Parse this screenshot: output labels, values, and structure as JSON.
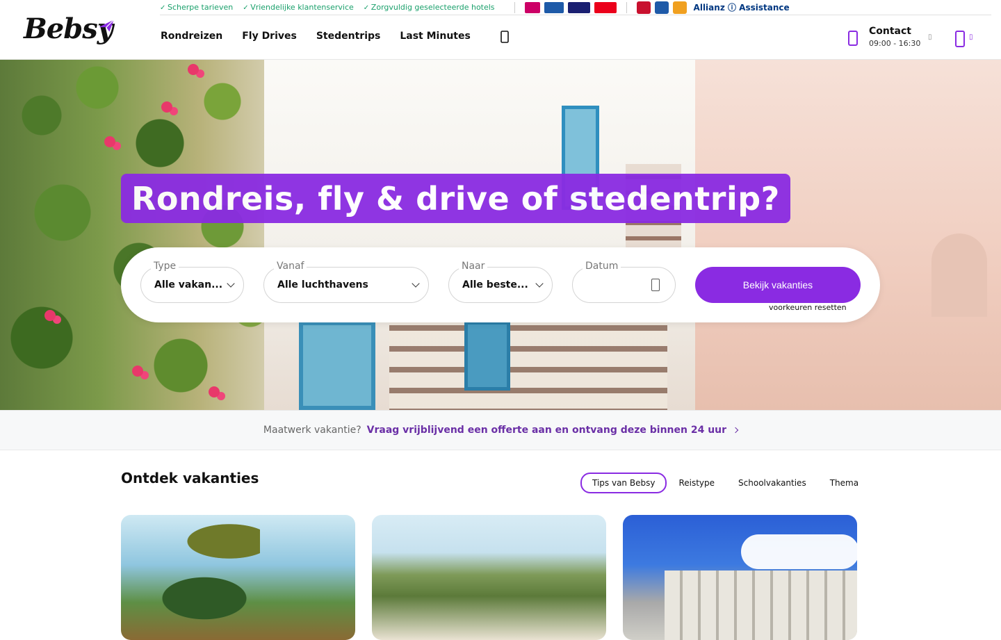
{
  "header": {
    "logo_text": "Bebsy",
    "usps": [
      "Scherpe tarieven",
      "Vriendelijke klantenservice",
      "Zorgvuldig geselecteerde hotels"
    ],
    "payment_icons": [
      "ideal-icon",
      "bancontact-icon",
      "visa-icon",
      "mastercard-icon"
    ],
    "trust_icons": [
      "reisgarantie-icon",
      "anvr-icon",
      "sgr-icon"
    ],
    "insurance_label": "Allianz ⓘ Assistance",
    "nav": [
      "Rondreizen",
      "Fly Drives",
      "Stedentrips",
      "Last Minutes"
    ],
    "contact": {
      "title": "Contact",
      "hours": "09:00 - 16:30"
    }
  },
  "hero": {
    "headline": "Rondreis, fly & drive of stedentrip?",
    "search": {
      "type": {
        "label": "Type",
        "value": "Alle vakan..."
      },
      "from": {
        "label": "Vanaf",
        "value": "Alle luchthavens"
      },
      "to": {
        "label": "Naar",
        "value": "Alle beste..."
      },
      "date": {
        "label": "Datum",
        "value": ""
      },
      "button": "Bekijk vakanties",
      "reset": "voorkeuren resetten"
    }
  },
  "promo": {
    "lead": "Maatwerk vakantie?",
    "link": "Vraag vrijblijvend een offerte aan en ontvang deze binnen 24 uur"
  },
  "discover": {
    "title": "Ontdek vakanties",
    "tabs": [
      "Tips van Bebsy",
      "Reistype",
      "Schoolvakanties",
      "Thema"
    ],
    "active_tab": "Tips van Bebsy"
  },
  "colors": {
    "brand": "#8a2be2",
    "usp_green": "#1aa06b",
    "promo_link": "#6a2fa6"
  }
}
